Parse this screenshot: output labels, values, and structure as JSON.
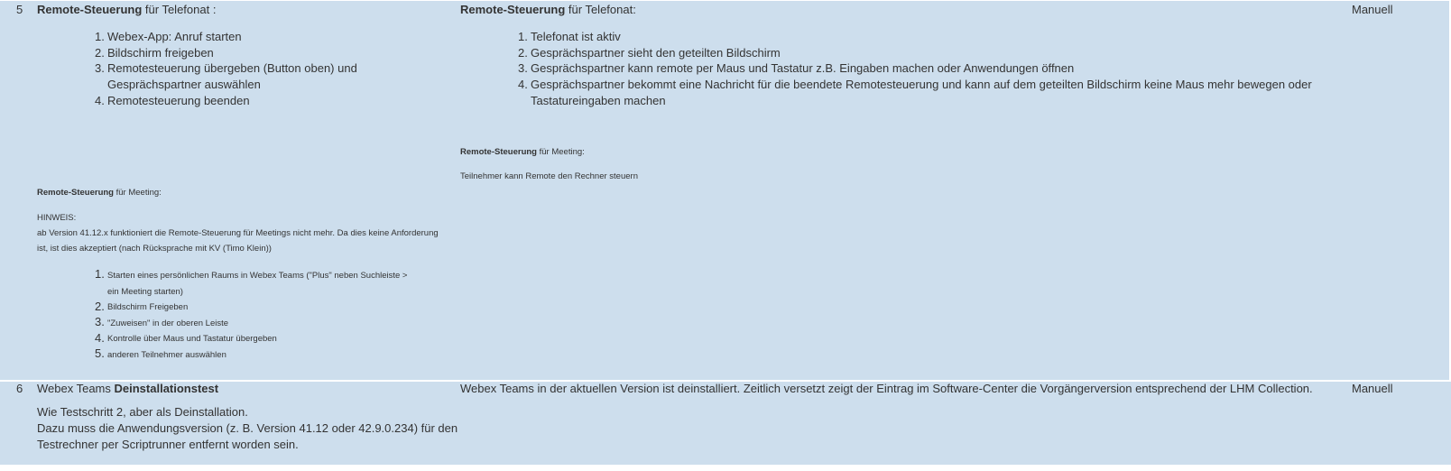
{
  "rows": [
    {
      "number": "5",
      "step": {
        "title_bold": "Remote-Steuerung",
        "title_rest": " für Telefonat :",
        "items": [
          "Webex-App: Anruf starten",
          "Bildschirm freigeben",
          "Remotesteuerung übergeben (Button oben) und",
          "Gesprächspartner auswählen",
          "Remotesteuerung beenden"
        ],
        "meeting_title_bold": "Remote-Steuerung",
        "meeting_title_rest": " für Meeting:",
        "hint_label": "HINWEIS:",
        "hint_line1": "ab Version 41.12.x funktioniert die Remote-Steuerung für Meetings nicht mehr. Da dies keine Anforderung",
        "hint_line2": "ist, ist dies akzeptiert (nach Rücksprache mit KV (Timo Klein))",
        "meeting_items": [
          "Starten eines persönlichen Raums in Webex Teams (\"Plus\" neben Suchleiste >",
          "ein Meeting starten)",
          "Bildschirm Freigeben",
          "\"Zuweisen\" in der oberen Leiste",
          "Kontrolle über Maus und Tastatur übergeben",
          "anderen Teilnehmer auswählen"
        ]
      },
      "expected": {
        "title_bold": "Remote-Steuerung",
        "title_rest": " für Telefonat:",
        "items": [
          "Telefonat ist aktiv",
          "Gesprächspartner sieht den geteilten Bildschirm",
          "Gesprächspartner kann remote per Maus und Tastatur z.B. Eingaben machen oder Anwendungen öffnen",
          "Gesprächspartner bekommt eine Nachricht für die beendete Remotesteuerung und kann auf dem geteilten Bildschirm keine Maus mehr bewegen oder",
          "Tastatureingaben machen"
        ],
        "meeting_title_bold": "Remote-Steuerung",
        "meeting_title_rest": " für Meeting:",
        "meeting_text": "Teilnehmer kann Remote den Rechner steuern"
      },
      "type": "Manuell"
    },
    {
      "number": "6",
      "step": {
        "title_plain": "Webex Teams ",
        "title_bold": "Deinstallationstest",
        "line1": "Wie Testschritt 2, aber als Deinstallation.",
        "line2": "Dazu muss die Anwendungsversion (z. B.  Version 41.12 oder 42.9.0.234) für den",
        "line3": "Testrechner per Scriptrunner entfernt worden sein."
      },
      "expected": {
        "text": "Webex Teams in der aktuellen Version ist deinstalliert. Zeitlich versetzt zeigt der Eintrag im Software-Center die Vorgängerversion entsprechend der LHM Collection."
      },
      "type": "Manuell"
    }
  ],
  "list_numbers": [
    "1.",
    "2.",
    "3.",
    "4.",
    "5."
  ]
}
